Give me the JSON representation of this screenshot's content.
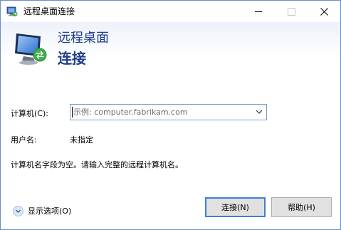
{
  "window": {
    "title": "远程桌面连接",
    "icon": "remote-desktop-icon",
    "controls": [
      "minimize",
      "maximize",
      "close"
    ]
  },
  "banner": {
    "line1": "远程桌面",
    "line2": "连接"
  },
  "form": {
    "computer_label": "计算机(C):",
    "computer_placeholder": "示例: computer.fabrikam.com",
    "computer_value": "",
    "user_label": "用户名:",
    "user_value": "未指定",
    "message": "计算机名字段为空。请输入完整的远程计算机名。"
  },
  "footer": {
    "show_options_label": "显示选项(O)",
    "connect_label": "连接(N)",
    "help_label": "帮助(H)"
  },
  "colors": {
    "banner_text": "#1e3d8a",
    "accent_border": "#3c7fd6",
    "window_border": "#6a8fc7"
  }
}
